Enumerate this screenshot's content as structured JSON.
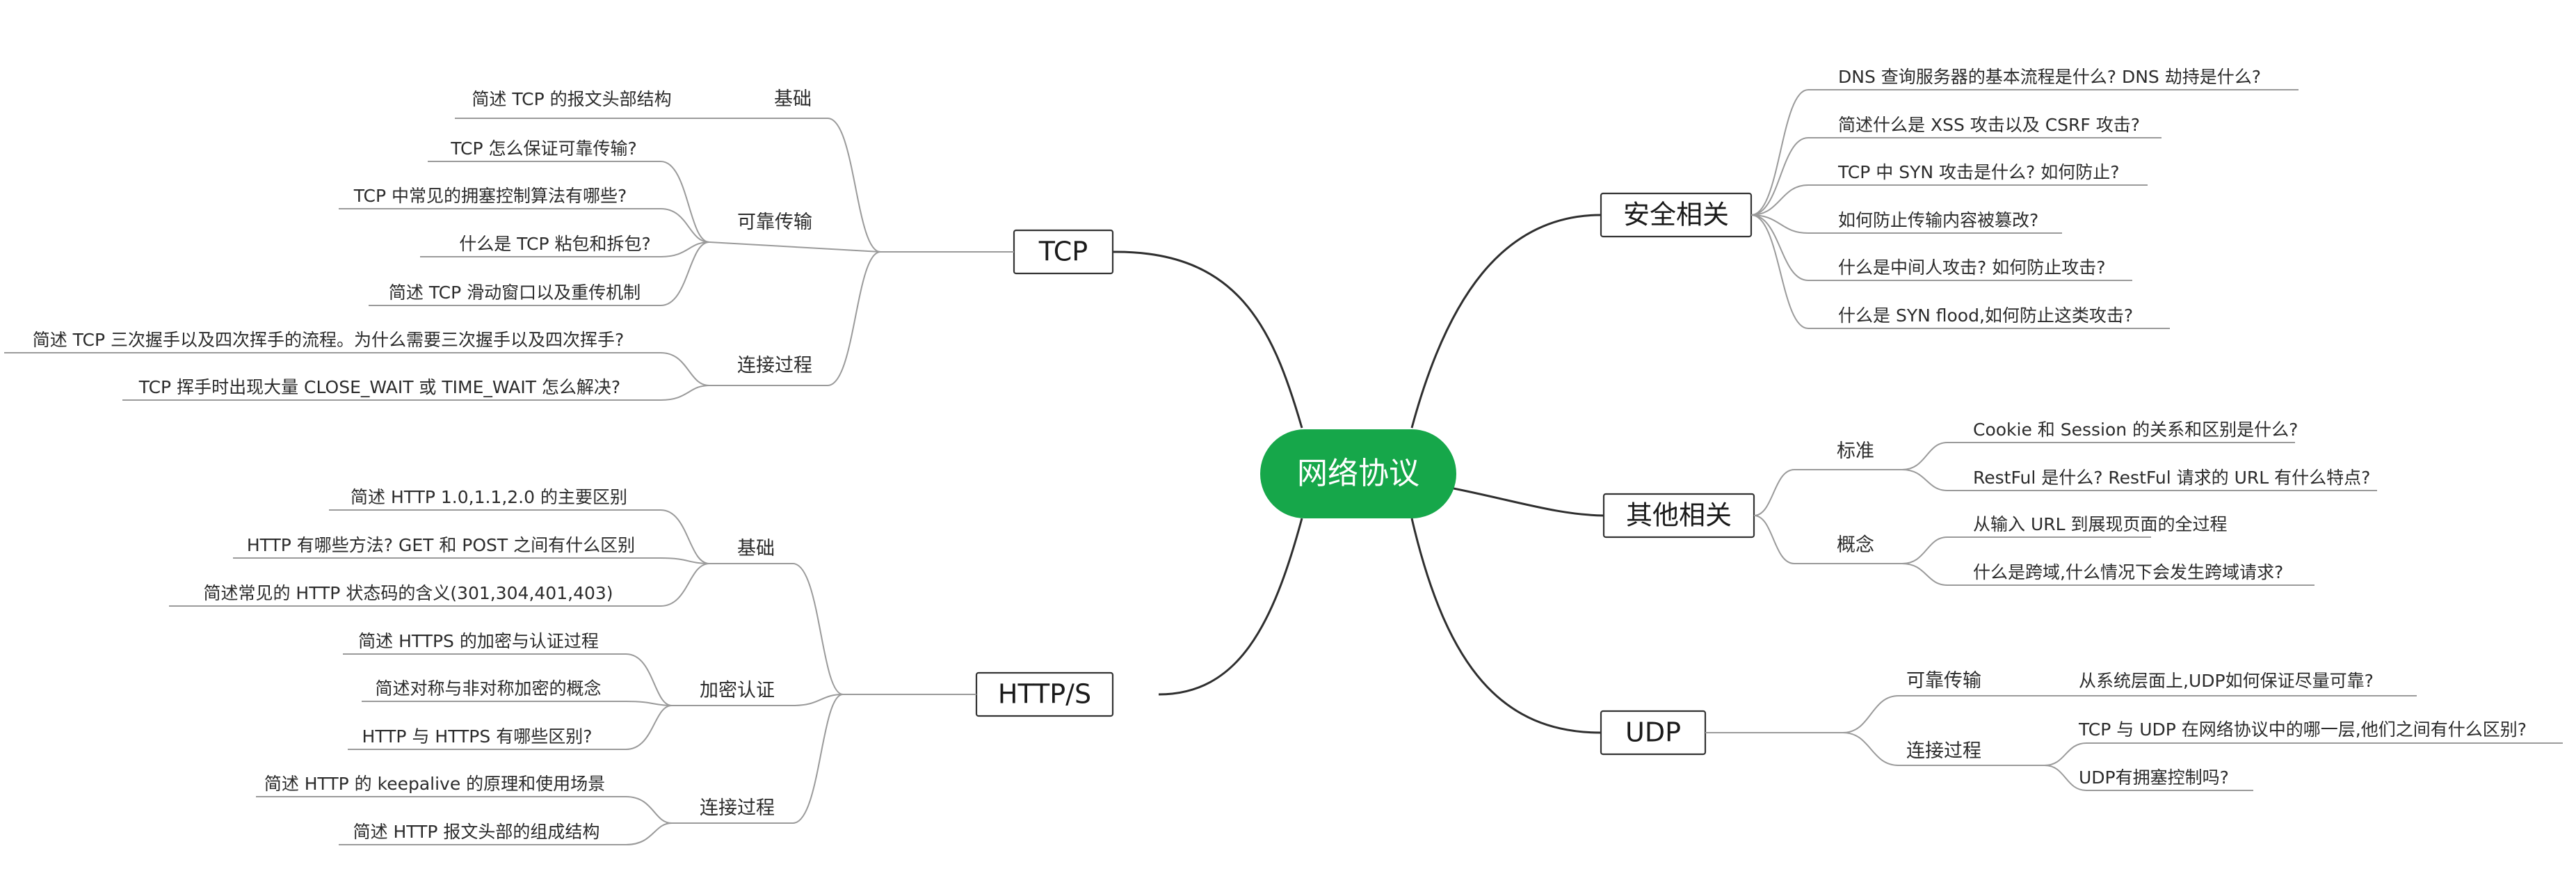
{
  "root": {
    "label": "网络协议",
    "color": "#16a74a"
  },
  "branches": {
    "tcp": {
      "label": "TCP",
      "groups": [
        {
          "label": "基础",
          "items": [
            "简述 TCP 的报文头部结构"
          ]
        },
        {
          "label": "可靠传输",
          "items": [
            "TCP 怎么保证可靠传输?",
            "TCP 中常见的拥塞控制算法有哪些?",
            "什么是 TCP 粘包和拆包?",
            "简述 TCP 滑动窗口以及重传机制"
          ]
        },
        {
          "label": "连接过程",
          "items": [
            "简述 TCP 三次握手以及四次挥手的流程。为什么需要三次握手以及四次挥手?",
            "TCP 挥手时出现大量 CLOSE_WAIT 或 TIME_WAIT 怎么解决?"
          ]
        }
      ]
    },
    "https": {
      "label": "HTTP/S",
      "groups": [
        {
          "label": "基础",
          "items": [
            "简述 HTTP 1.0,1.1,2.0 的主要区别",
            "HTTP 有哪些方法? GET 和 POST 之间有什么区别",
            "简述常见的 HTTP 状态码的含义(301,304,401,403)"
          ]
        },
        {
          "label": "加密认证",
          "items": [
            "简述 HTTPS 的加密与认证过程",
            "简述对称与非对称加密的概念",
            "HTTP 与 HTTPS 有哪些区别?"
          ]
        },
        {
          "label": "连接过程",
          "items": [
            "简述 HTTP 的 keepalive 的原理和使用场景",
            "简述 HTTP 报文头部的组成结构"
          ]
        }
      ]
    },
    "security": {
      "label": "安全相关",
      "items": [
        "DNS 查询服务器的基本流程是什么? DNS 劫持是什么?",
        "简述什么是 XSS 攻击以及 CSRF 攻击?",
        "TCP 中 SYN 攻击是什么? 如何防止?",
        "如何防止传输内容被篡改?",
        "什么是中间人攻击? 如何防止攻击?",
        "什么是 SYN flood,如何防止这类攻击?"
      ]
    },
    "other": {
      "label": "其他相关",
      "groups": [
        {
          "label": "标准",
          "items": [
            "Cookie 和 Session 的关系和区别是什么?",
            "RestFul 是什么? RestFul 请求的 URL 有什么特点?"
          ]
        },
        {
          "label": "概念",
          "items": [
            "从输入 URL 到展现页面的全过程",
            "什么是跨域,什么情况下会发生跨域请求?"
          ]
        }
      ]
    },
    "udp": {
      "label": "UDP",
      "groups": [
        {
          "label": "可靠传输",
          "items": [
            "从系统层面上,UDP如何保证尽量可靠?"
          ]
        },
        {
          "label": "连接过程",
          "items": [
            "TCP 与 UDP 在网络协议中的哪一层,他们之间有什么区别?",
            "UDP有拥塞控制吗?"
          ]
        }
      ]
    }
  }
}
